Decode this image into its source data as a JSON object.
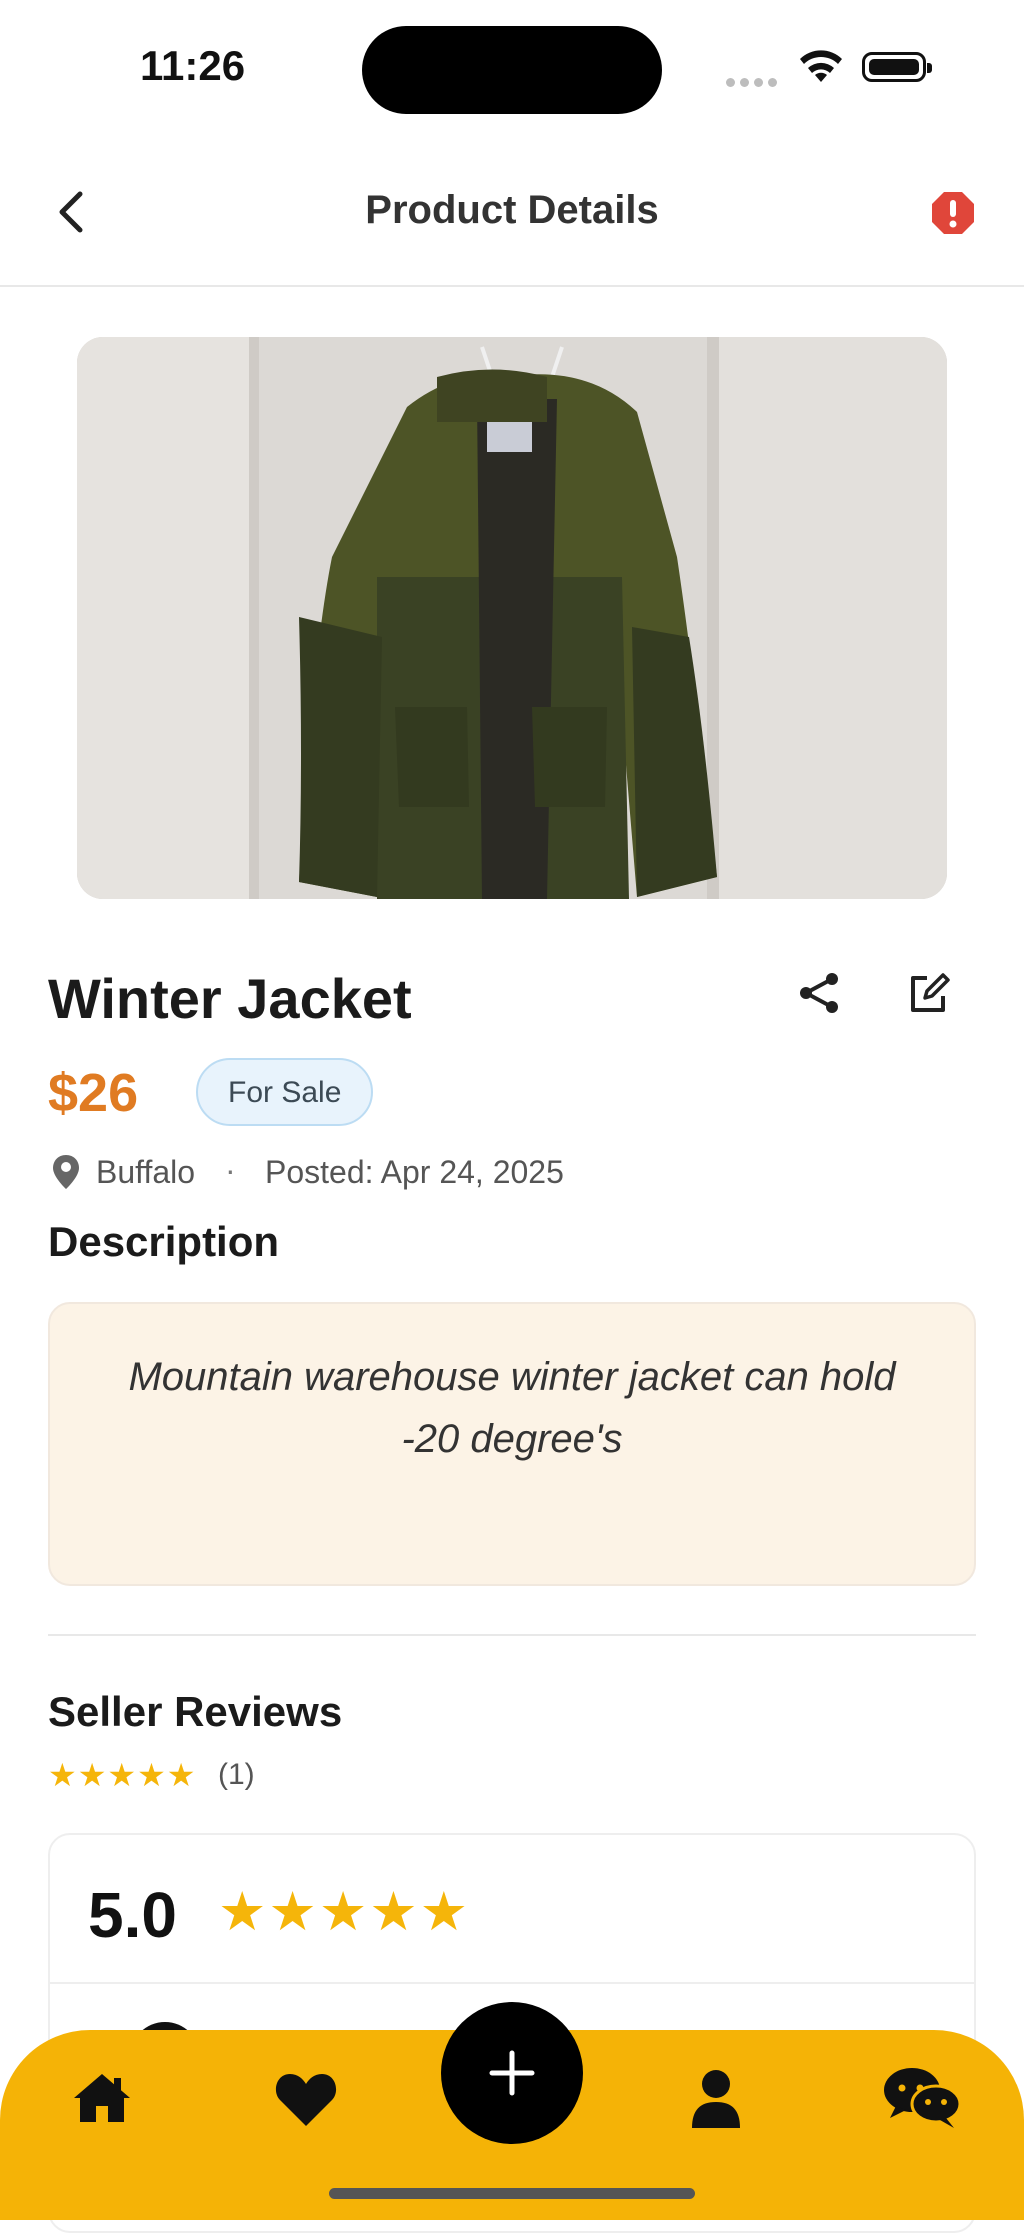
{
  "status_bar": {
    "time": "11:26"
  },
  "header": {
    "title": "Product Details"
  },
  "product": {
    "name": "Winter Jacket",
    "price": "$26",
    "badge": "For Sale",
    "location": "Buffalo",
    "separator": "·",
    "posted": "Posted: Apr 24, 2025"
  },
  "description": {
    "heading": "Description",
    "text": "Mountain warehouse winter jacket can hold -20 degree's"
  },
  "reviews": {
    "heading": "Seller Reviews",
    "stars": "★★★★★",
    "count": "(1)",
    "score": "5.0",
    "score_stars": "★★★★★",
    "rating": 5
  },
  "colors": {
    "accent": "#f5b306",
    "price": "#e07b22",
    "star": "#f5b50a",
    "report": "#e0463a"
  },
  "icons": [
    "back-chevron-icon",
    "alert-icon",
    "share-icon",
    "edit-icon",
    "location-pin-icon",
    "home-icon",
    "heart-icon",
    "plus-icon",
    "user-icon",
    "chat-icon"
  ]
}
